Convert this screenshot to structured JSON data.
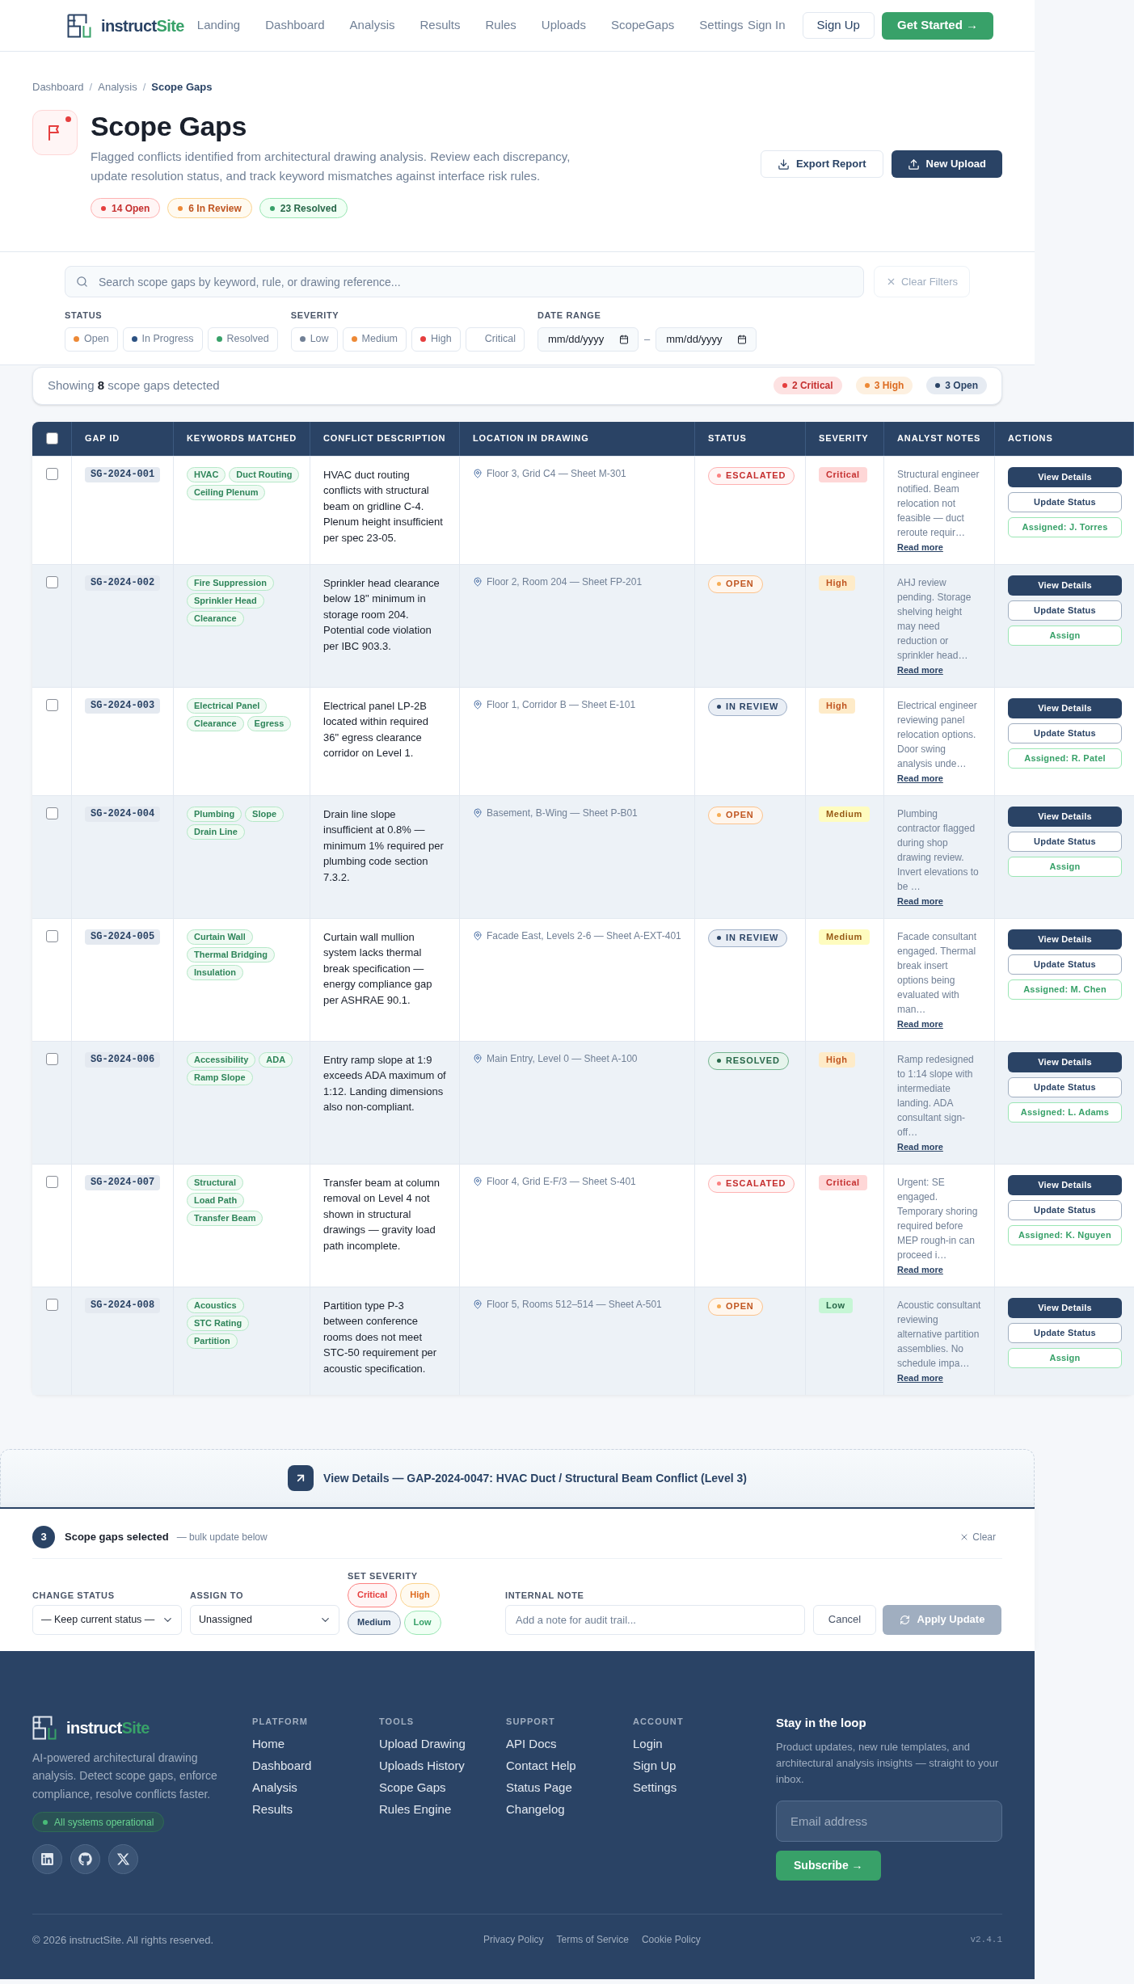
{
  "nav": {
    "logo": {
      "main": "instruct",
      "accent": "Site"
    },
    "links": [
      "Landing",
      "Dashboard",
      "Analysis",
      "Results",
      "Rules",
      "Uploads",
      "ScopeGaps",
      "Settings"
    ],
    "sign_in": "Sign In",
    "sign_up": "Sign Up",
    "cta": "Get Started →"
  },
  "breadcrumb": {
    "separator": "/",
    "items": [
      {
        "label": "Dashboard",
        "current": false
      },
      {
        "label": "Analysis",
        "current": false
      },
      {
        "label": "Scope Gaps",
        "current": true
      }
    ]
  },
  "page": {
    "title": "Scope Gaps",
    "description": "Flagged conflicts identified from architectural drawing analysis. Review each discrepancy, update resolution status, and track keyword mismatches against interface risk rules.",
    "badges": [
      {
        "kind": "open",
        "label": "14 Open"
      },
      {
        "kind": "review",
        "label": "6 In Review"
      },
      {
        "kind": "resolved",
        "label": "23 Resolved"
      }
    ],
    "buttons": [
      {
        "kind": "export",
        "label": "Export Report"
      },
      {
        "kind": "upload",
        "label": "New Upload"
      }
    ]
  },
  "filters": {
    "search": {
      "placeholder": "Search scope gaps by keyword, rule, or drawing reference..."
    },
    "clear": {
      "label": "Clear Filters",
      "disabled": true
    },
    "status": {
      "label": "STATUS",
      "options": [
        {
          "label": "Open",
          "color": "#ed8936",
          "selected": false
        },
        {
          "label": "In Progress",
          "color": "#2c5282",
          "selected": false
        },
        {
          "label": "Resolved",
          "color": "#38a169",
          "selected": false
        }
      ]
    },
    "severity": {
      "label": "SEVERITY",
      "options": [
        {
          "label": "Low",
          "color": "#718096",
          "selected": false
        },
        {
          "label": "Medium",
          "color": "#ed8936",
          "selected": false
        },
        {
          "label": "High",
          "color": "#e53e3e",
          "selected": false
        },
        {
          "label": "Critical",
          "selected": false
        }
      ]
    },
    "date_range": {
      "label": "DATE RANGE",
      "from": {
        "placeholder": "mm/dd/yyyy"
      },
      "separator": "–",
      "to": {
        "placeholder": "mm/dd/yyyy"
      }
    }
  },
  "summary": {
    "text": "Showing **8** scope gaps detected",
    "pills": [
      {
        "kind": "critical",
        "label": "2 Critical"
      },
      {
        "kind": "high",
        "label": "3 High"
      },
      {
        "kind": "open",
        "label": "3 Open"
      }
    ]
  },
  "table": {
    "header_checkbox": {
      "checked": false
    },
    "columns": [
      "GAP ID",
      "KEYWORDS MATCHED",
      "CONFLICT DESCRIPTION",
      "LOCATION IN DRAWING",
      "STATUS",
      "SEVERITY",
      "ANALYST NOTES",
      "ACTIONS"
    ],
    "rows": [
      {
        "checked": false,
        "id": "SG-2024-001",
        "keywords": [
          "HVAC",
          "Duct Routing",
          "Ceiling Plenum"
        ],
        "description": "HVAC duct routing conflicts with structural beam on gridline C-4. Plenum height insufficient per spec 23-05.",
        "location": "Floor 3, Grid C4 — Sheet M-301",
        "status": {
          "kind": "escalated",
          "label": "ESCALATED"
        },
        "severity": {
          "kind": "critical",
          "label": "Critical"
        },
        "notes": "Structural engineer notified. Beam relocation not feasible — duct reroute requir…",
        "read_more": "Read more",
        "actions": {
          "view": "View Details",
          "update": "Update Status",
          "assign": "Assigned: J. Torres"
        }
      },
      {
        "checked": false,
        "id": "SG-2024-002",
        "keywords": [
          "Fire Suppression",
          "Sprinkler Head",
          "Clearance"
        ],
        "description": "Sprinkler head clearance below 18\" minimum in storage room 204. Potential code violation per IBC 903.3.",
        "location": "Floor 2, Room 204 — Sheet FP-201",
        "status": {
          "kind": "open",
          "label": "OPEN"
        },
        "severity": {
          "kind": "high",
          "label": "High"
        },
        "notes": "AHJ review pending. Storage shelving height may need reduction or sprinkler head…",
        "read_more": "Read more",
        "actions": {
          "view": "View Details",
          "update": "Update Status",
          "assign": "Assign"
        }
      },
      {
        "checked": false,
        "id": "SG-2024-003",
        "keywords": [
          "Electrical Panel",
          "Clearance",
          "Egress"
        ],
        "description": "Electrical panel LP-2B located within required 36\" egress clearance corridor on Level 1.",
        "location": "Floor 1, Corridor B — Sheet E-101",
        "status": {
          "kind": "review",
          "label": "IN REVIEW"
        },
        "severity": {
          "kind": "high",
          "label": "High"
        },
        "notes": "Electrical engineer reviewing panel relocation options. Door swing analysis unde…",
        "read_more": "Read more",
        "actions": {
          "view": "View Details",
          "update": "Update Status",
          "assign": "Assigned: R. Patel"
        }
      },
      {
        "checked": false,
        "id": "SG-2024-004",
        "keywords": [
          "Plumbing",
          "Slope",
          "Drain Line"
        ],
        "description": "Drain line slope insufficient at 0.8% — minimum 1% required per plumbing code section 7.3.2.",
        "location": "Basement, B-Wing — Sheet P-B01",
        "status": {
          "kind": "open",
          "label": "OPEN"
        },
        "severity": {
          "kind": "medium",
          "label": "Medium"
        },
        "notes": "Plumbing contractor flagged during shop drawing review. Invert elevations to be …",
        "read_more": "Read more",
        "actions": {
          "view": "View Details",
          "update": "Update Status",
          "assign": "Assign"
        }
      },
      {
        "checked": false,
        "id": "SG-2024-005",
        "keywords": [
          "Curtain Wall",
          "Thermal Bridging",
          "Insulation"
        ],
        "description": "Curtain wall mullion system lacks thermal break specification — energy compliance gap per ASHRAE 90.1.",
        "location": "Facade East, Levels 2-6 — Sheet A-EXT-401",
        "status": {
          "kind": "review",
          "label": "IN REVIEW"
        },
        "severity": {
          "kind": "medium",
          "label": "Medium"
        },
        "notes": "Facade consultant engaged. Thermal break insert options being evaluated with man…",
        "read_more": "Read more",
        "actions": {
          "view": "View Details",
          "update": "Update Status",
          "assign": "Assigned: M. Chen"
        }
      },
      {
        "checked": false,
        "id": "SG-2024-006",
        "keywords": [
          "Accessibility",
          "ADA",
          "Ramp Slope"
        ],
        "description": "Entry ramp slope at 1:9 exceeds ADA maximum of 1:12. Landing dimensions also non-compliant.",
        "location": "Main Entry, Level 0 — Sheet A-100",
        "status": {
          "kind": "resolved",
          "label": "RESOLVED"
        },
        "severity": {
          "kind": "high",
          "label": "High"
        },
        "notes": "Ramp redesigned to 1:14 slope with intermediate landing. ADA consultant sign-off…",
        "read_more": "Read more",
        "actions": {
          "view": "View Details",
          "update": "Update Status",
          "assign": "Assigned: L. Adams"
        }
      },
      {
        "checked": false,
        "id": "SG-2024-007",
        "keywords": [
          "Structural",
          "Load Path",
          "Transfer Beam"
        ],
        "description": "Transfer beam at column removal on Level 4 not shown in structural drawings — gravity load path incomplete.",
        "location": "Floor 4, Grid E-F/3 — Sheet S-401",
        "status": {
          "kind": "escalated",
          "label": "ESCALATED"
        },
        "severity": {
          "kind": "critical",
          "label": "Critical"
        },
        "notes": "Urgent: SE engaged. Temporary shoring required before MEP rough-in can proceed i…",
        "read_more": "Read more",
        "actions": {
          "view": "View Details",
          "update": "Update Status",
          "assign": "Assigned: K. Nguyen"
        }
      },
      {
        "checked": false,
        "id": "SG-2024-008",
        "keywords": [
          "Acoustics",
          "STC Rating",
          "Partition"
        ],
        "description": "Partition type P-3 between conference rooms does not meet STC-50 requirement per acoustic specification.",
        "location": "Floor 5, Rooms 512–514 — Sheet A-501",
        "status": {
          "kind": "open",
          "label": "OPEN"
        },
        "severity": {
          "kind": "low",
          "label": "Low"
        },
        "notes": "Acoustic consultant reviewing alternative partition assemblies. No schedule impa…",
        "read_more": "Read more",
        "actions": {
          "view": "View Details",
          "update": "Update Status",
          "assign": "Assign"
        }
      }
    ]
  },
  "detail_link": {
    "text": "View Details — GAP-2024-0047: HVAC Duct / Structural Beam Conflict (Level 3)"
  },
  "bulk_update": {
    "count": "3",
    "title": "Scope gaps selected",
    "hint": "— bulk update below",
    "clear": "Clear",
    "status_select": {
      "label": "CHANGE STATUS",
      "value": "— Keep current status —"
    },
    "assign_select": {
      "label": "ASSIGN TO",
      "value": "Unassigned"
    },
    "severity": {
      "label": "SET SEVERITY",
      "options": [
        {
          "kind": "critical",
          "label": "Critical",
          "selected": false
        },
        {
          "kind": "high",
          "label": "High",
          "selected": false
        },
        {
          "kind": "medium",
          "label": "Medium",
          "selected": false
        },
        {
          "kind": "low",
          "label": "Low",
          "selected": false
        }
      ]
    },
    "note": {
      "label": "INTERNAL NOTE",
      "placeholder": "Add a note for audit trail..."
    },
    "cancel": "Cancel",
    "apply": {
      "label": "Apply Update",
      "disabled": true
    }
  },
  "footer": {
    "logo": {
      "main": "instruct",
      "accent": "Site"
    },
    "tagline": "AI-powered architectural drawing analysis. Detect scope gaps, enforce compliance, resolve conflicts faster.",
    "status": "All systems operational",
    "social": [
      {
        "kind": "linkedin"
      },
      {
        "kind": "github"
      },
      {
        "kind": "x"
      }
    ],
    "columns": [
      {
        "title": "PLATFORM",
        "links": [
          "Home",
          "Dashboard",
          "Analysis",
          "Results"
        ]
      },
      {
        "title": "TOOLS",
        "links": [
          "Upload Drawing",
          "Uploads History",
          "Scope Gaps",
          "Rules Engine"
        ]
      },
      {
        "title": "SUPPORT",
        "links": [
          "API Docs",
          "Contact Help",
          "Status Page",
          "Changelog"
        ]
      },
      {
        "title": "ACCOUNT",
        "links": [
          "Login",
          "Sign Up",
          "Settings"
        ]
      }
    ],
    "newsletter": {
      "title": "Stay in the loop",
      "text": "Product updates, new rule templates, and architectural analysis insights — straight to your inbox.",
      "email": {
        "placeholder": "Email address"
      },
      "button": "Subscribe →"
    },
    "copyright": "© 2026 instructSite. All rights reserved.",
    "legal": [
      "Privacy Policy",
      "Terms of Service",
      "Cookie Policy"
    ],
    "version": "v2.4.1"
  }
}
